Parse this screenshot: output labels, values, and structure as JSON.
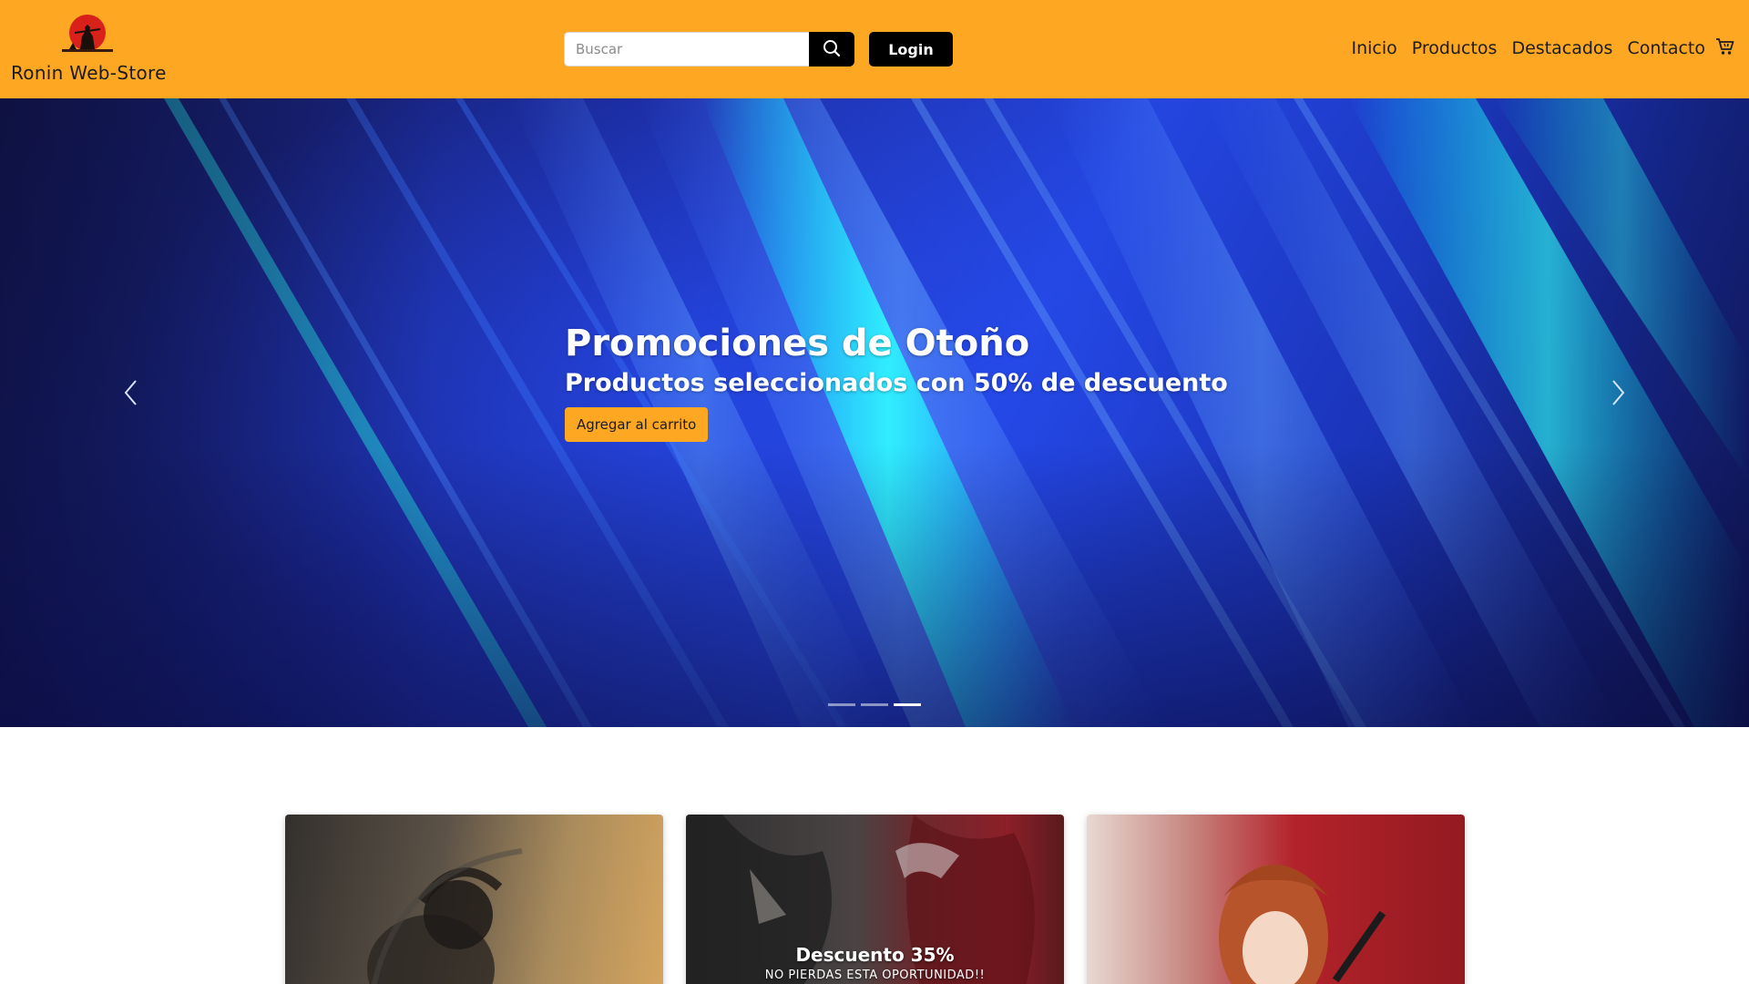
{
  "header": {
    "brand_name": "Ronin Web-Store",
    "logo_icon": "ronin-samurai-logo-icon",
    "search_placeholder": "Buscar",
    "search_icon": "search-icon",
    "login_label": "Login",
    "nav": [
      {
        "label": "Inicio"
      },
      {
        "label": "Productos"
      },
      {
        "label": "Destacados"
      },
      {
        "label": "Contacto"
      }
    ],
    "cart_icon": "shopping-cart-icon"
  },
  "hero": {
    "title": "Promociones de Otoño",
    "subtitle": "Productos seleccionados con 50% de descuento",
    "cta_label": "Agregar al carrito",
    "prev_icon": "chevron-left-icon",
    "next_icon": "chevron-right-icon",
    "slide_count": 3,
    "active_slide": 3
  },
  "promo_cards": [
    {
      "title": "",
      "subtitle": ""
    },
    {
      "title": "Descuento 35%",
      "subtitle": "NO PIERDAS ESTA OPORTUNIDAD!!"
    },
    {
      "title": "",
      "subtitle": ""
    }
  ],
  "colors": {
    "navbar_bg": "#fea722",
    "accent": "#fea722",
    "button_dark": "#000000",
    "hero_blue": "#2446e0",
    "hero_cyan": "#00e5ff"
  }
}
